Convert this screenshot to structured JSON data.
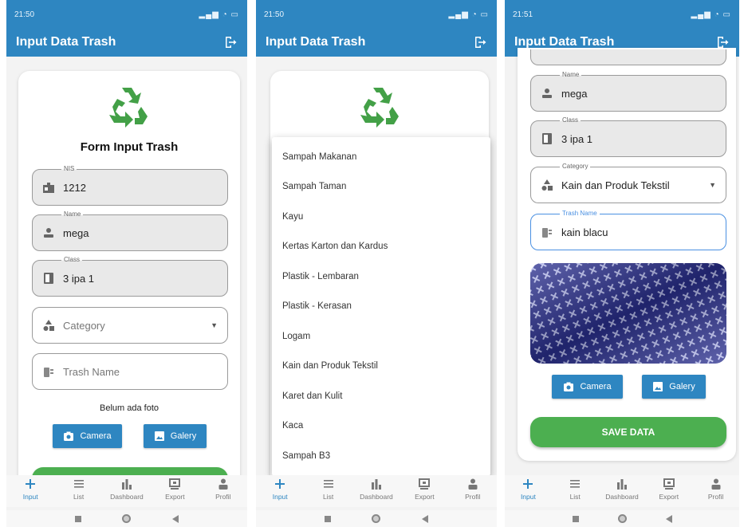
{
  "status": {
    "time_1": "21:50",
    "time_2": "21:50",
    "time_3": "21:51",
    "dots": "···"
  },
  "app": {
    "title": "Input Data Trash"
  },
  "form": {
    "title": "Form Input Trash",
    "nis_label": "NIS",
    "nis_value": "1212",
    "name_label": "Name",
    "name_value": "mega",
    "class_label": "Class",
    "class_value": "3 ipa 1",
    "category_hint": "Category",
    "category_label": "Category",
    "category_value": "Kain dan Produk Tekstil",
    "trash_hint": "Trash Name",
    "trash_label": "Trash Name",
    "trash_value": "kain blacu",
    "no_photo": "Belum ada foto",
    "camera_label": "Camera",
    "gallery_label": "Galery",
    "save_label": "SAVE DATA"
  },
  "dropdown": {
    "options": [
      "Sampah Makanan",
      "Sampah Taman",
      "Kayu",
      "Kertas Karton dan Kardus",
      "Plastik - Lembaran",
      "Plastik - Kerasan",
      "Logam",
      "Kain dan Produk Tekstil",
      "Karet dan Kulit",
      "Kaca",
      "Sampah B3"
    ]
  },
  "nav": {
    "input": "Input",
    "list": "List",
    "dashboard": "Dashboard",
    "export": "Export",
    "profil": "Profil"
  },
  "colors": {
    "primary": "#2e86c1",
    "save": "#4caf50",
    "recycle": "#43a047",
    "focus": "#4a90e2"
  },
  "icons": [
    "recycle-icon",
    "logout-icon",
    "badge-icon",
    "person-icon",
    "book-icon",
    "category-icon",
    "trash-icon",
    "camera-icon",
    "image-icon",
    "plus-icon",
    "list-icon",
    "chart-icon",
    "export-icon"
  ]
}
